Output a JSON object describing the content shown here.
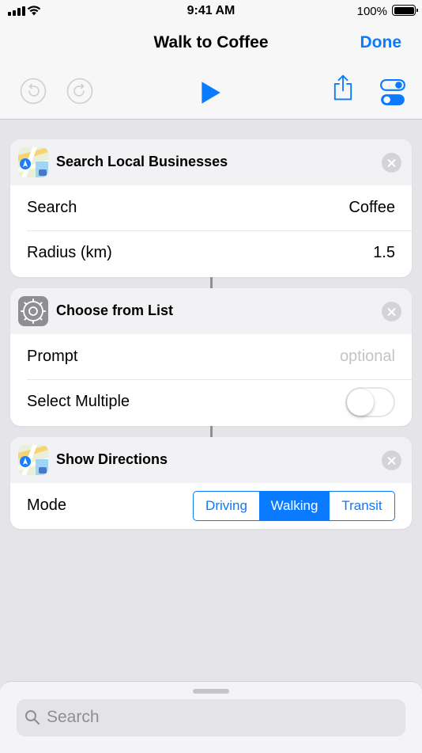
{
  "status_bar": {
    "time": "9:41 AM",
    "battery": "100%"
  },
  "nav": {
    "title": "Walk to Coffee",
    "done_label": "Done"
  },
  "toolbar": {
    "undo_icon": "undo-icon",
    "redo_icon": "redo-icon",
    "play_icon": "play-icon",
    "share_icon": "share-icon",
    "settings_icon": "settings-toggle-icon"
  },
  "actions": [
    {
      "title": "Search Local Businesses",
      "icon": "maps-icon",
      "rows": [
        {
          "label": "Search",
          "value": "Coffee"
        },
        {
          "label": "Radius (km)",
          "value": "1.5"
        }
      ]
    },
    {
      "title": "Choose from List",
      "icon": "gear-icon",
      "rows": [
        {
          "label": "Prompt",
          "placeholder": "optional"
        },
        {
          "label": "Select Multiple",
          "toggle": false
        }
      ]
    },
    {
      "title": "Show Directions",
      "icon": "maps-icon",
      "rows": [
        {
          "label": "Mode",
          "options": [
            "Driving",
            "Walking",
            "Transit"
          ],
          "selected": "Walking"
        }
      ]
    }
  ],
  "search": {
    "placeholder": "Search"
  },
  "colors": {
    "accent": "#0a7aff",
    "background": "#e4e4e9",
    "header": "#f2f2f5"
  }
}
